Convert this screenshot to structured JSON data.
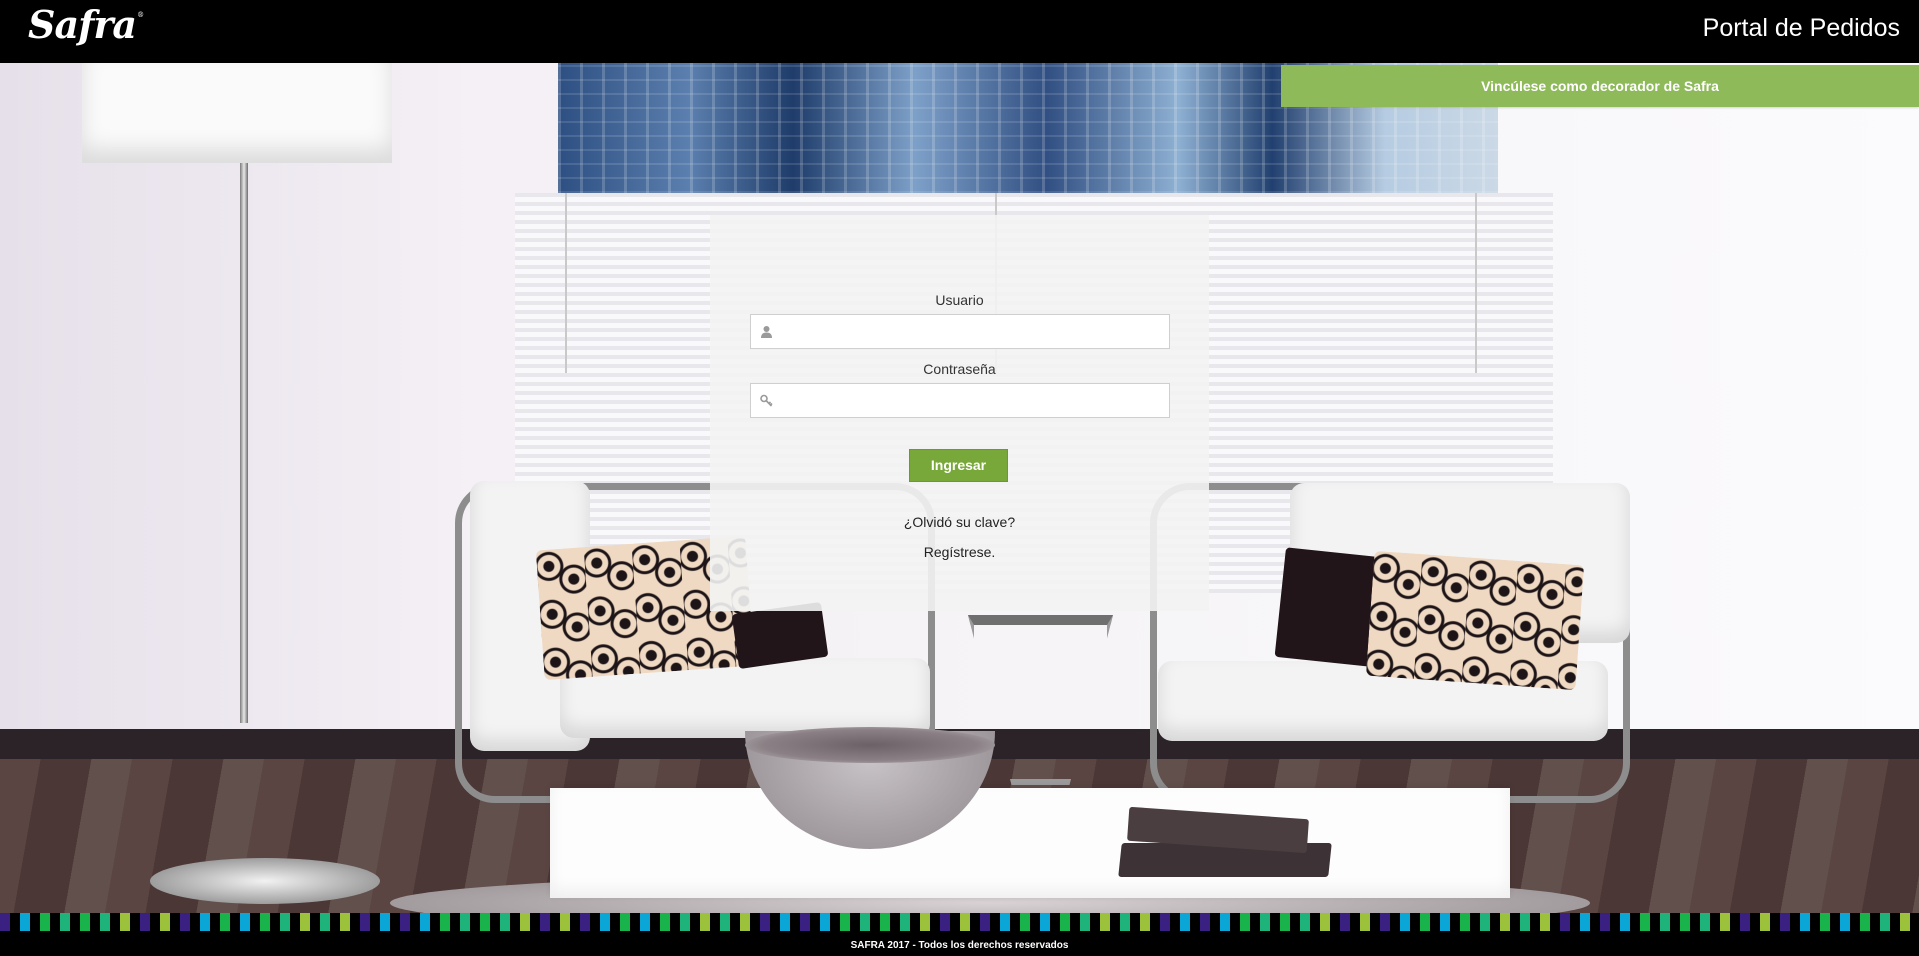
{
  "header": {
    "logo_text": "Safra",
    "logo_mark": "®",
    "title": "Portal de Pedidos"
  },
  "banner": {
    "label": "Vincúlese como decorador de Safra",
    "color": "#8fba5a"
  },
  "login": {
    "username_label": "Usuario",
    "username_value": "",
    "username_icon": "user-icon",
    "password_label": "Contraseña",
    "password_value": "",
    "password_icon": "key-icon",
    "submit_label": "Ingresar",
    "forgot_link": "¿Olvidó su clave?",
    "register_link": "Regístrese."
  },
  "footer": {
    "text": "SAFRA 2017 - Todos los derechos reservados"
  },
  "colors": {
    "accent_green": "#79a83a",
    "strip_palette": [
      "#3a2080",
      "#1db37a",
      "#0aa6d6",
      "#9bc23a",
      "#18b34a"
    ]
  }
}
